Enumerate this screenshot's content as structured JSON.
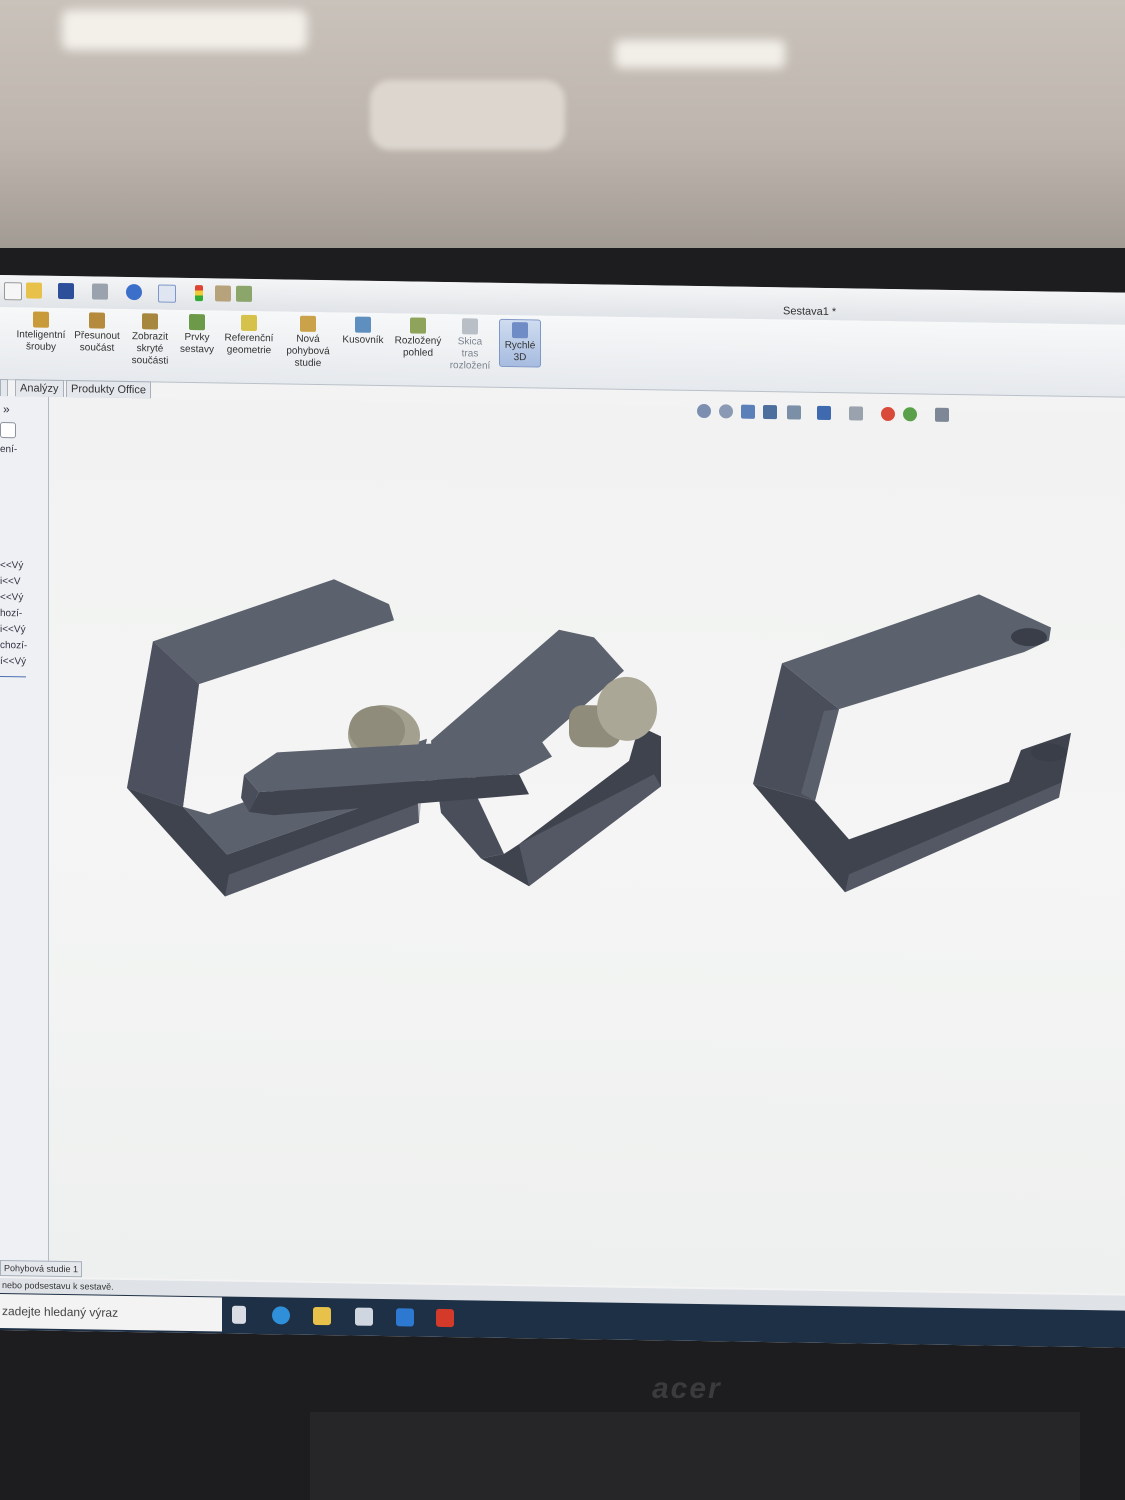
{
  "window": {
    "title": "Sestava1 *"
  },
  "ribbon": {
    "buttons": [
      {
        "label": "Inteligentní šrouby"
      },
      {
        "label": "Přesunout součást"
      },
      {
        "label": "Zobrazit skryté součásti"
      },
      {
        "label": "Prvky sestavy"
      },
      {
        "label": "Referenční geometrie"
      },
      {
        "label": "Nová pohybová studie"
      },
      {
        "label": "Kusovník"
      },
      {
        "label": "Rozložený pohled"
      },
      {
        "label": "Skica tras rozložení"
      },
      {
        "label": "Rychlé 3D"
      }
    ]
  },
  "tabs": [
    {
      "label": "Analýzy"
    },
    {
      "label": "Produkty Office"
    }
  ],
  "left_panel": {
    "chevron": "»",
    "snippets": [
      "ení-",
      "<<Vý",
      "i<<V",
      "<<Vý",
      "hozí-",
      "i<<Vý",
      "chozí-",
      "í<<Vý"
    ]
  },
  "motion_tab": "Pohybová studie 1",
  "status_text": "nebo podsestavu k sestavě.",
  "taskbar": {
    "search_placeholder": "zadejte hledaný výraz"
  },
  "monitor": {
    "brand": "acer"
  },
  "colors": {
    "link_face": "#4a4e5a",
    "link_top": "#5c616e",
    "link_edge": "#6e7380",
    "pin": "#9b9787",
    "ribbon_active": "#a7bce0",
    "taskbar": "#1e3045"
  }
}
